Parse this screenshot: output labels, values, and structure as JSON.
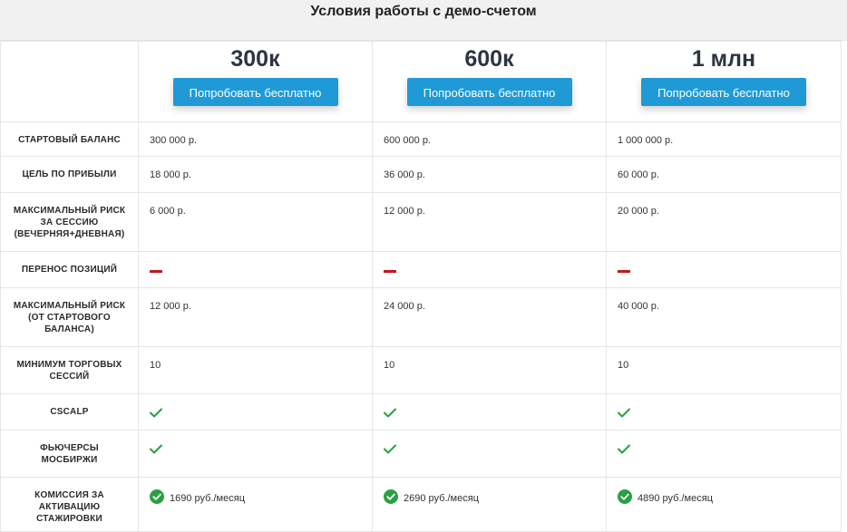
{
  "page": {
    "title": "Условия работы с демо-счетом"
  },
  "plans": [
    {
      "name": "300к",
      "button": "Попробовать бесплатно"
    },
    {
      "name": "600к",
      "button": "Попробовать бесплатно"
    },
    {
      "name": "1 млн",
      "button": "Попробовать бесплатно"
    }
  ],
  "rows": [
    {
      "label_lines": [
        "СТАРТОВЫЙ БАЛАНС"
      ],
      "type": "text",
      "values": [
        "300 000 р.",
        "600 000 р.",
        "1 000 000 р."
      ]
    },
    {
      "label_lines": [
        "ЦЕЛЬ ПО ПРИБЫЛИ"
      ],
      "type": "text",
      "values": [
        "18 000 р.",
        "36 000 р.",
        "60 000 р."
      ]
    },
    {
      "label_lines": [
        "МАКСИМАЛЬНЫЙ РИСК",
        "ЗА СЕССИЮ",
        "(ВЕЧЕРНЯЯ+ДНЕВНАЯ)"
      ],
      "type": "text",
      "values": [
        "6 000 р.",
        "12 000 р.",
        "20 000 р."
      ]
    },
    {
      "label_lines": [
        "ПЕРЕНОС ПОЗИЦИЙ"
      ],
      "type": "dash",
      "icon": "minus-icon",
      "color": "#c0171c"
    },
    {
      "label_lines": [
        "МАКСИМАЛЬНЫЙ РИСК",
        "(ОТ СТАРТОВОГО",
        "БАЛАНСА)"
      ],
      "type": "text",
      "values": [
        "12 000 р.",
        "24 000 р.",
        "40 000 р."
      ]
    },
    {
      "label_lines": [
        "МИНИМУМ ТОРГОВЫХ",
        "СЕССИЙ"
      ],
      "type": "text",
      "values": [
        "10",
        "10",
        "10"
      ]
    },
    {
      "label_lines": [
        "CSCALP"
      ],
      "type": "check",
      "icon": "checkmark-icon",
      "color": "#2aa043"
    },
    {
      "label_lines": [
        "ФЬЮЧЕРСЫ",
        "МОСБИРЖИ"
      ],
      "type": "check",
      "icon": "checkmark-icon",
      "color": "#2aa043"
    },
    {
      "label_lines": [
        "КОМИССИЯ ЗА",
        "АКТИВАЦИЮ",
        "СТАЖИРОВКИ"
      ],
      "type": "commission",
      "icon": "check-circle-icon",
      "color": "#2aa043",
      "values": [
        "1690 руб./месяц",
        "2690 руб./месяц",
        "4890 руб./месяц"
      ]
    }
  ],
  "colors": {
    "button": "#1f9ad6",
    "dash": "#c0171c",
    "check": "#2aa043"
  }
}
